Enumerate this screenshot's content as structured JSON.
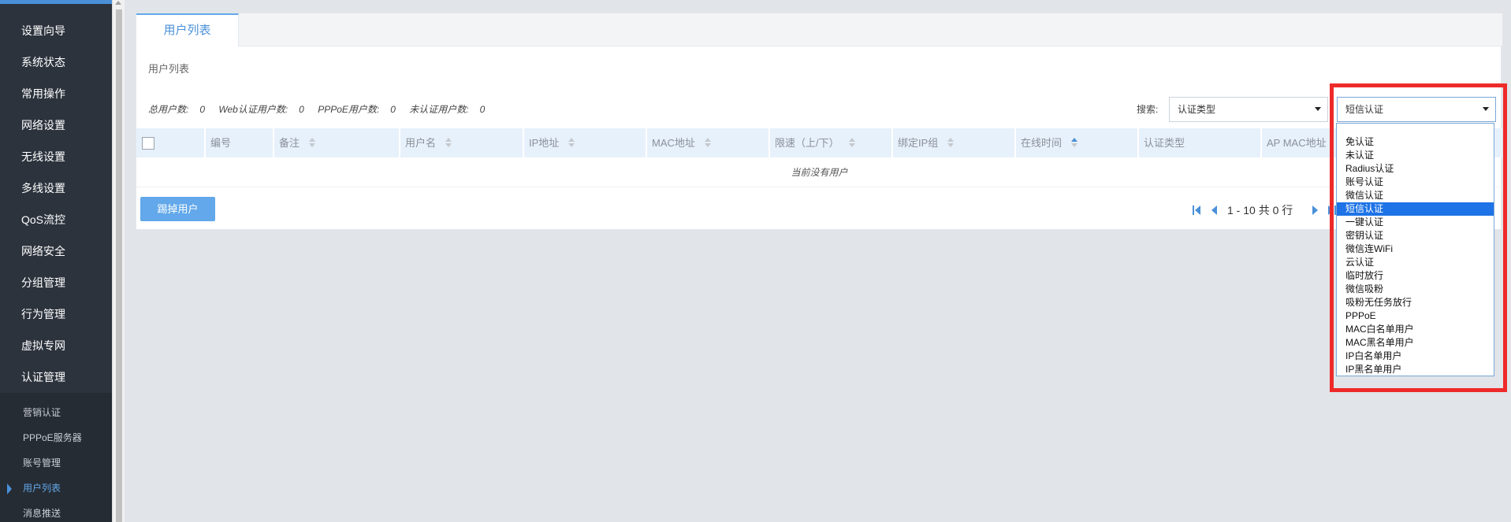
{
  "sidebar": {
    "items": [
      {
        "label": "设置向导"
      },
      {
        "label": "系统状态"
      },
      {
        "label": "常用操作"
      },
      {
        "label": "网络设置"
      },
      {
        "label": "无线设置"
      },
      {
        "label": "多线设置"
      },
      {
        "label": "QoS流控"
      },
      {
        "label": "网络安全"
      },
      {
        "label": "分组管理"
      },
      {
        "label": "行为管理"
      },
      {
        "label": "虚拟专网"
      },
      {
        "label": "认证管理"
      }
    ],
    "sub_items": [
      {
        "label": "营销认证"
      },
      {
        "label": "PPPoE服务器"
      },
      {
        "label": "账号管理"
      },
      {
        "label": "用户列表",
        "active": true
      },
      {
        "label": "消息推送"
      }
    ]
  },
  "tab": {
    "label": "用户列表"
  },
  "section_title": "用户列表",
  "stats": {
    "total_label": "总用户数:",
    "total_value": "0",
    "web_label": "Web认证用户数:",
    "web_value": "0",
    "pppoe_label": "PPPoE用户数:",
    "pppoe_value": "0",
    "unauth_label": "未认证用户数:",
    "unauth_value": "0"
  },
  "search": {
    "label": "搜索:",
    "field_select": "认证类型",
    "value_select": "短信认证"
  },
  "table": {
    "columns": [
      {
        "label": "编号",
        "sortable": false
      },
      {
        "label": "备注",
        "sortable": true
      },
      {
        "label": "用户名",
        "sortable": true
      },
      {
        "label": "IP地址",
        "sortable": true
      },
      {
        "label": "MAC地址",
        "sortable": true
      },
      {
        "label": "限速（上/下）",
        "sortable": true
      },
      {
        "label": "绑定IP组",
        "sortable": true
      },
      {
        "label": "在线时间",
        "sortable": true,
        "sort_active": true
      },
      {
        "label": "认证类型",
        "sortable": false
      },
      {
        "label": "AP MAC地址",
        "sortable": false
      }
    ],
    "empty_text": "当前没有用户"
  },
  "actions": {
    "kick_label": "踢掉用户"
  },
  "pager": {
    "text": "1 - 10 共 0 行"
  },
  "dropdown": {
    "options": [
      "免认证",
      "未认证",
      "Radius认证",
      "账号认证",
      "微信认证",
      "短信认证",
      "一键认证",
      "密钥认证",
      "微信连WiFi",
      "云认证",
      "临时放行",
      "微信吸粉",
      "吸粉无任务放行",
      "PPPoE",
      "MAC白名单用户",
      "MAC黑名单用户",
      "IP白名单用户",
      "IP黑名单用户"
    ],
    "selected": "短信认证"
  },
  "colors": {
    "sidebar_bg": "#2c333d",
    "accent": "#4a90d9",
    "header_bg": "#e7f1fb",
    "highlight": "#ee2a2a",
    "selected_option": "#1e73e6"
  }
}
